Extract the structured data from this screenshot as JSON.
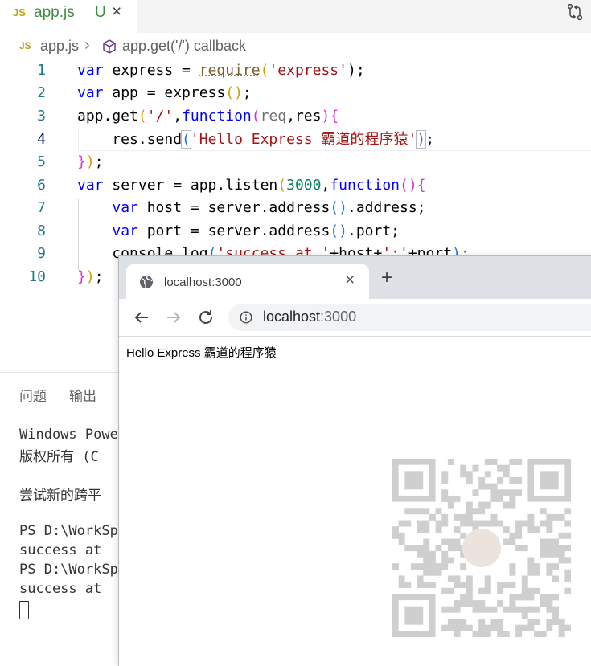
{
  "editor": {
    "tab": {
      "icon": "JS",
      "filename": "app.js",
      "status": "U",
      "close": "×"
    },
    "breadcrumb": {
      "icon": "JS",
      "file": "app.js",
      "separator": "›",
      "symbol": "app.get('/') callback"
    },
    "line_numbers": [
      "1",
      "2",
      "3",
      "4",
      "5",
      "6",
      "7",
      "8",
      "9",
      "10"
    ],
    "current_line": 4,
    "code": {
      "l1": [
        "var",
        " express = ",
        "require",
        "(",
        "'express'",
        ");"
      ],
      "l2": [
        "var",
        " app = express",
        "()",
        ";"
      ],
      "l3": [
        "app.get",
        "(",
        "'/'",
        ",",
        "function",
        "(",
        "req",
        ",res",
        ")",
        "{"
      ],
      "l4": [
        "    res.send",
        "(",
        "'Hello Express 霸道的程序猿'",
        ")",
        ";"
      ],
      "l5": [
        "}",
        ")",
        ";"
      ],
      "l6": [
        "var",
        " server = app.listen",
        "(",
        "3000",
        ",",
        "function",
        "()",
        "{"
      ],
      "l7": [
        "    ",
        "var",
        " host = server.address",
        "()",
        ".address;"
      ],
      "l8": [
        "    ",
        "var",
        " port = server.address",
        "()",
        ".port;"
      ],
      "l9": [
        "    console.log",
        "(",
        "'success at '",
        "+host+",
        "':'",
        "+port",
        ");"
      ],
      "l10": [
        "}",
        ")",
        ";"
      ]
    }
  },
  "panel": {
    "tabs": [
      "问题",
      "输出"
    ],
    "terminal_lines": [
      "Windows Powe",
      "版权所有 (C",
      "",
      "尝试新的跨平",
      "",
      "PS D:\\WorkSp",
      "success at ",
      "PS D:\\WorkSp",
      "success at "
    ]
  },
  "browser": {
    "tab_title": "localhost:3000",
    "tab_close": "×",
    "new_tab": "+",
    "url_host": "localhost",
    "url_port": ":3000",
    "page_text": "Hello Express 霸道的程序猿"
  },
  "icons": {
    "compare": "compare-changes-icon",
    "breadcrumb_symbol": "method-cube-icon",
    "globe": "globe-icon",
    "back": "back-arrow-icon",
    "forward": "forward-arrow-icon",
    "reload": "reload-icon",
    "info": "info-icon"
  },
  "colors": {
    "keyword": "#0000ff",
    "string": "#a31515",
    "number": "#098658",
    "git_untracked": "#3e8e41",
    "line_number": "#237893"
  }
}
